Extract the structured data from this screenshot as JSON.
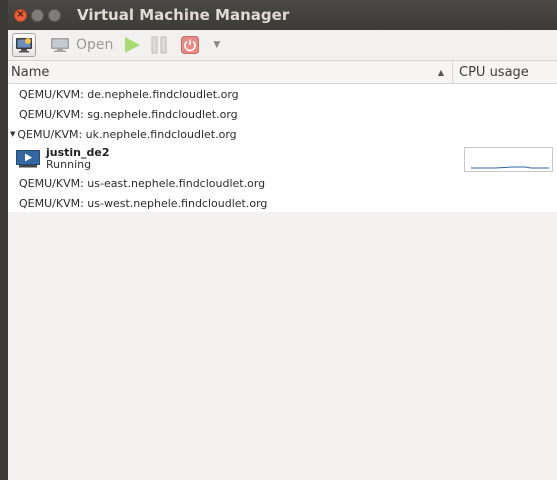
{
  "window": {
    "title": "Virtual Machine Manager"
  },
  "titlebar_buttons": [
    "close",
    "minimize",
    "maximize"
  ],
  "toolbar": {
    "new_icon": "new-vm-icon",
    "open_label": "Open",
    "run_icon": "play-icon",
    "pause_icon": "pause-icon",
    "shutdown_icon": "power-icon",
    "menu_icon": "dropdown-arrow-icon"
  },
  "columns": {
    "name": "Name",
    "cpu": "CPU usage",
    "sort": "ascending"
  },
  "connections": [
    {
      "label": "QEMU/KVM: de.nephele.findcloudlet.org"
    },
    {
      "label": "QEMU/KVM: sg.nephele.findcloudlet.org"
    },
    {
      "label": "QEMU/KVM: uk.nephele.findcloudlet.org",
      "expanded": true
    },
    {
      "label": "QEMU/KVM: us-east.nephele.findcloudlet.org"
    },
    {
      "label": "QEMU/KVM: us-west.nephele.findcloudlet.org"
    }
  ],
  "vm": {
    "name": "justin_de2",
    "status": "Running",
    "accent": "#3466a3"
  },
  "colors": {
    "close": "#e9603a",
    "run": "#8fd24a",
    "power": "#e06a62"
  }
}
